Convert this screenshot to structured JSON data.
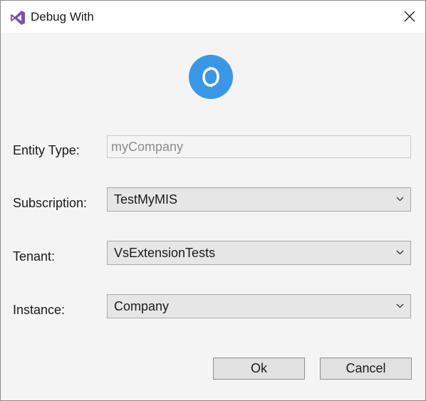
{
  "window": {
    "title": "Debug With",
    "app_icon": "visual-studio-icon",
    "close_icon": "close-icon"
  },
  "logo": {
    "icon": "sync-logo-icon",
    "color": "#3a97e6"
  },
  "form": {
    "entity_type": {
      "label": "Entity Type:",
      "value": "myCompany"
    },
    "subscription": {
      "label": "Subscription:",
      "value": "TestMyMIS"
    },
    "tenant": {
      "label": "Tenant:",
      "value": "VsExtensionTests"
    },
    "instance": {
      "label": "Instance:",
      "value": "Company"
    }
  },
  "buttons": {
    "ok": "Ok",
    "cancel": "Cancel"
  }
}
